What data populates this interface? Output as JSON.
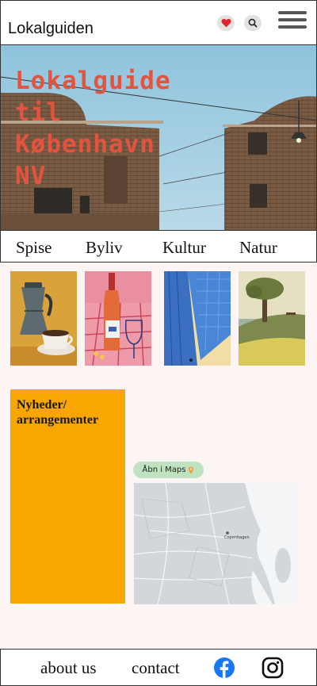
{
  "header": {
    "brand": "Lokalguiden",
    "icons": [
      "heart-icon",
      "search-icon",
      "hamburger-menu-icon"
    ],
    "heart_color": "#e0242f"
  },
  "hero": {
    "title_lines": [
      "Lokalguide",
      "til",
      "København",
      "NV"
    ],
    "title_color": "#e2543e"
  },
  "categories": [
    {
      "label": "Spise",
      "image": "moka-pot-and-coffee-cup"
    },
    {
      "label": "Byliv",
      "image": "wine-bottle-and-glass"
    },
    {
      "label": "Kultur",
      "image": "tall-building"
    },
    {
      "label": "Natur",
      "image": "tree-on-hill"
    }
  ],
  "news": {
    "title_line1": "Nyheder/",
    "title_line2": "arrangementer",
    "color": "#f9a603"
  },
  "maps": {
    "button_label": "Åbn i Maps",
    "button_icon": "pin-icon",
    "map_label": "Copenhagen"
  },
  "footer": {
    "about": "about us",
    "contact": "contact",
    "icons": [
      "facebook-icon",
      "instagram-icon"
    ],
    "facebook_color": "#1877f2"
  }
}
